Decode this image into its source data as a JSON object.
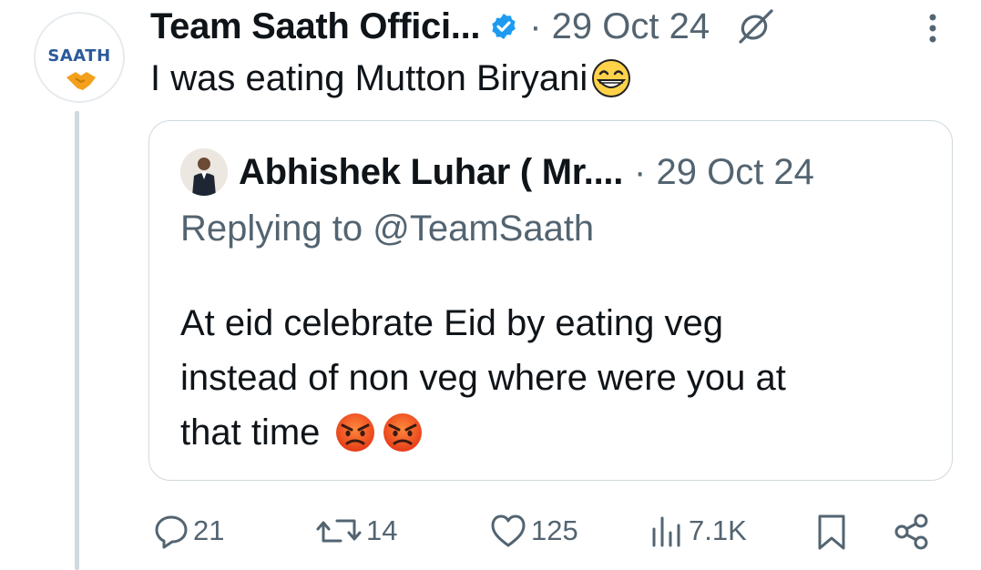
{
  "tweet": {
    "avatar_label": "SAATH",
    "author": "Team Saath Offici...",
    "timestamp": "· 29 Oct 24",
    "text": "I was eating Mutton Biryani",
    "text_emoji": "grinning-face-emoji"
  },
  "quote": {
    "author": "Abhishek Luhar ( Mr....",
    "timestamp": "· 29 Oct 24",
    "replying_to": "Replying to @TeamSaath",
    "lines": [
      "At eid celebrate Eid by eating veg",
      "instead of non veg where were you at",
      "that time"
    ],
    "line_emoji": "angry-face-emoji"
  },
  "actions": {
    "replies": "21",
    "reposts": "14",
    "likes": "125",
    "views": "7.1K"
  },
  "colors": {
    "text": "#0f1419",
    "muted": "#536471",
    "verified": "#1d9bf0",
    "border": "#cfd9de"
  }
}
